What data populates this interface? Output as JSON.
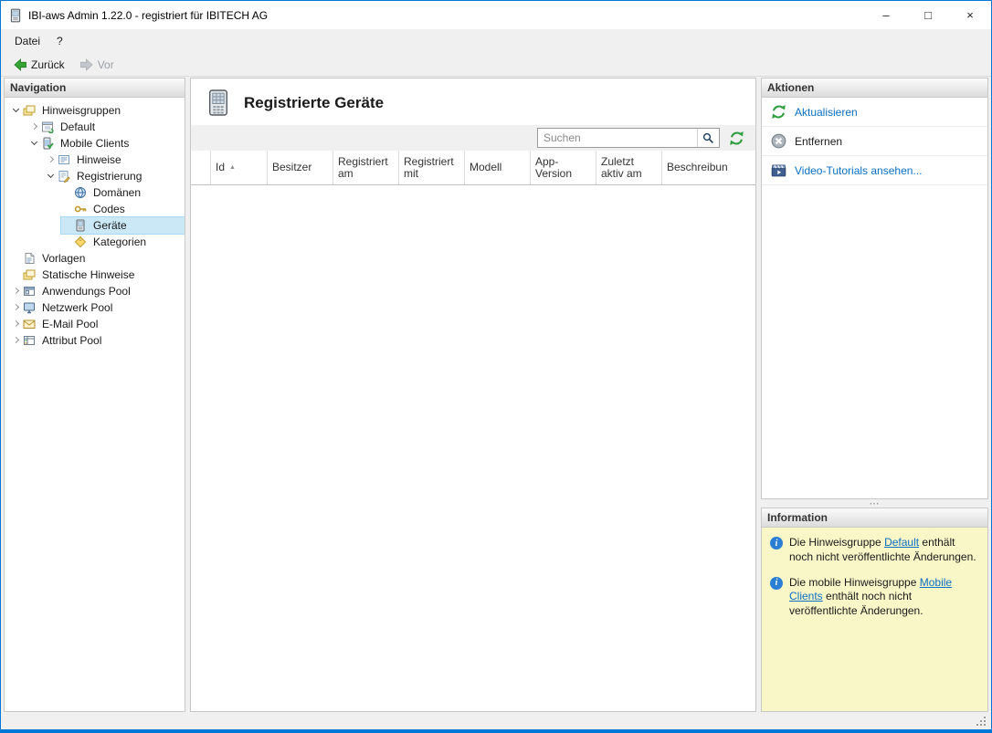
{
  "window": {
    "title": "IBI-aws Admin 1.22.0 - registriert für IBITECH AG",
    "controls": {
      "minimize": "–",
      "maximize": "□",
      "close": "×"
    }
  },
  "menubar": {
    "items": [
      "Datei",
      "?"
    ]
  },
  "toolbar": {
    "back_label": "Zurück",
    "forward_label": "Vor"
  },
  "navigation": {
    "header": "Navigation",
    "items": [
      {
        "label": "Hinweisgruppen",
        "icon": "notice-groups-icon",
        "level": 0,
        "state": "expanded",
        "selected": false
      },
      {
        "label": "Default",
        "icon": "default-group-icon",
        "level": 1,
        "state": "collapsed",
        "selected": false
      },
      {
        "label": "Mobile Clients",
        "icon": "mobile-clients-icon",
        "level": 1,
        "state": "expanded",
        "selected": false
      },
      {
        "label": "Hinweise",
        "icon": "notices-icon",
        "level": 2,
        "state": "collapsed",
        "selected": false
      },
      {
        "label": "Registrierung",
        "icon": "registration-icon",
        "level": 2,
        "state": "expanded",
        "selected": false
      },
      {
        "label": "Domänen",
        "icon": "domains-icon",
        "level": 3,
        "state": "leaf",
        "selected": false
      },
      {
        "label": "Codes",
        "icon": "key-icon",
        "level": 3,
        "state": "leaf",
        "selected": false
      },
      {
        "label": "Geräte",
        "icon": "device-icon",
        "level": 3,
        "state": "leaf",
        "selected": true
      },
      {
        "label": "Kategorien",
        "icon": "categories-icon",
        "level": 3,
        "state": "leaf",
        "selected": false
      },
      {
        "label": "Vorlagen",
        "icon": "templates-icon",
        "level": 0,
        "state": "leaf",
        "selected": false
      },
      {
        "label": "Statische Hinweise",
        "icon": "static-notices-icon",
        "level": 0,
        "state": "leaf",
        "selected": false
      },
      {
        "label": "Anwendungs Pool",
        "icon": "application-pool-icon",
        "level": 0,
        "state": "collapsed",
        "selected": false
      },
      {
        "label": "Netzwerk Pool",
        "icon": "network-pool-icon",
        "level": 0,
        "state": "collapsed",
        "selected": false
      },
      {
        "label": "E-Mail Pool",
        "icon": "email-pool-icon",
        "level": 0,
        "state": "collapsed",
        "selected": false
      },
      {
        "label": "Attribut Pool",
        "icon": "attribute-pool-icon",
        "level": 0,
        "state": "collapsed",
        "selected": false
      }
    ]
  },
  "main": {
    "title": "Registrierte Geräte",
    "search_placeholder": "Suchen",
    "table": {
      "columns": [
        "Id",
        "Besitzer",
        "Registriert am",
        "Registriert mit",
        "Modell",
        "App-Version",
        "Zuletzt aktiv am",
        "Beschreibun"
      ],
      "sort": {
        "column": "Id",
        "direction": "ascending"
      },
      "rows": []
    }
  },
  "actions": {
    "header": "Aktionen",
    "items": [
      {
        "label": "Aktualisieren",
        "icon": "refresh-icon",
        "style": "link"
      },
      {
        "label": "Entfernen",
        "icon": "remove-icon",
        "style": "plain"
      },
      {
        "label": "Video-Tutorials ansehen...",
        "icon": "video-icon",
        "style": "link"
      }
    ]
  },
  "information": {
    "header": "Information",
    "notes": [
      {
        "prefix": "Die Hinweisgruppe ",
        "link": "Default",
        "suffix": " enthält noch nicht veröffentlichte Änderungen."
      },
      {
        "prefix": "Die mobile Hinweisgruppe ",
        "link": "Mobile Clients",
        "suffix": " enthält noch nicht veröffentlichte Änderungen."
      }
    ]
  },
  "colors": {
    "accent": "#0078d7",
    "link": "#0b6fc2",
    "tree_selection": "#cbe8f6",
    "info_background": "#f9f6c8",
    "icon_green": "#2e9e3e"
  }
}
